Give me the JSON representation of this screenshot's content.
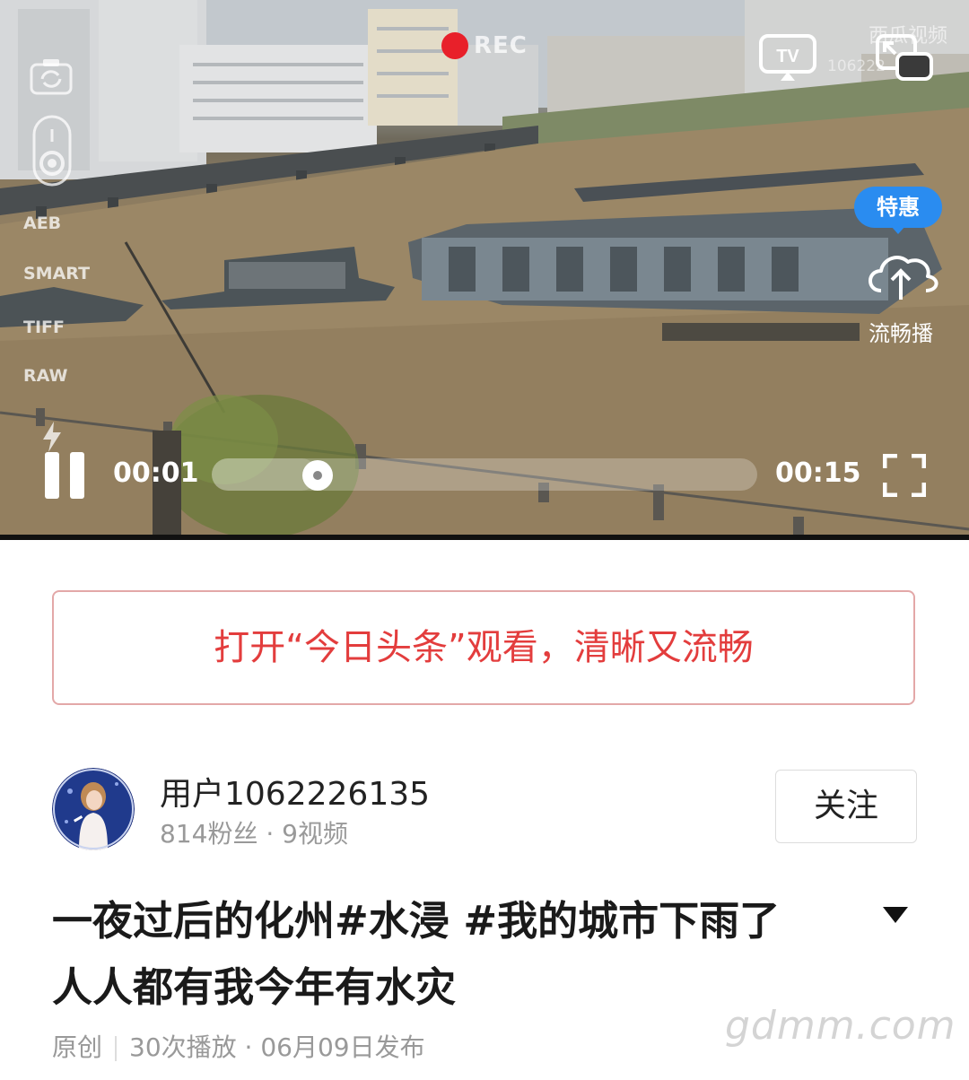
{
  "player": {
    "rec_label": "REC",
    "camera_modes": [
      "AEB",
      "SMART",
      "TIFF",
      "RAW"
    ],
    "watermark": "西瓜视频",
    "watermark_id": "106222",
    "promo_badge": "特惠",
    "smooth_play_label": "流畅播",
    "current_time": "00:01",
    "duration": "00:15",
    "progress_fraction": 0.06,
    "state": "playing"
  },
  "open_app_banner": {
    "text": "打开“今日头条”观看，清晰又流畅",
    "color": "#e33d3d"
  },
  "author": {
    "name": "用户1062226135",
    "stats": "814粉丝 · 9视频",
    "follow_label": "关注"
  },
  "video": {
    "title": "一夜过后的化州#水浸 #我的城市下雨了 人人都有我今年有水灾",
    "original_label": "原创",
    "plays_and_date": "30次播放 · 06月09日发布"
  },
  "site_watermark": "gdmm.com",
  "icons": [
    "camera-switch-icon",
    "shutter-icon",
    "flash-icon",
    "tv-cast-icon",
    "pip-icon",
    "cloud-upload-icon",
    "pause-icon",
    "fullscreen-icon",
    "chevron-down-icon"
  ]
}
